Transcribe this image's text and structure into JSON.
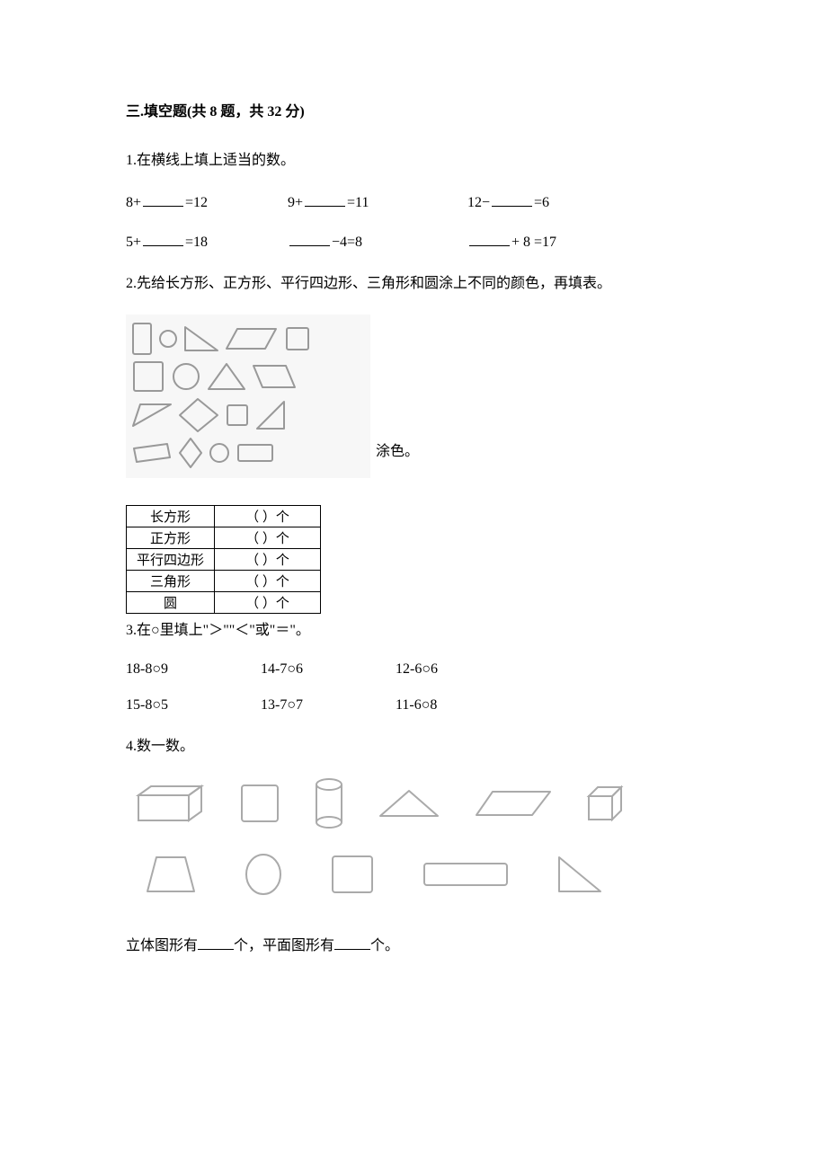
{
  "section": {
    "number": "三",
    "title": "填空题",
    "count_label": "共 8 题，共 32 分"
  },
  "q1": {
    "prompt": "1.在横线上填上适当的数。",
    "items": [
      {
        "pre": "8+",
        "post": "=12"
      },
      {
        "pre": "9+",
        "post": "=11"
      },
      {
        "pre": "12−",
        "post": "=6"
      },
      {
        "pre": "5+",
        "post": "=18"
      },
      {
        "pre": "",
        "post": "−4=8"
      },
      {
        "pre": "",
        "post": "+ 8 =17"
      }
    ]
  },
  "q2": {
    "prompt": "2.先给长方形、正方形、平行四边形、三角形和圆涂上不同的颜色，再填表。",
    "color_label": "涂色。",
    "table_rows": [
      {
        "label": "长方形",
        "value": "（      ）个"
      },
      {
        "label": "正方形",
        "value": "（      ）个"
      },
      {
        "label": "平行四边形",
        "value": "（      ）个"
      },
      {
        "label": "三角形",
        "value": "（      ）个"
      },
      {
        "label": "圆",
        "value": "（      ）个"
      }
    ]
  },
  "q3": {
    "prompt": "3.在○里填上\"＞\"\"＜\"或\"＝\"。",
    "items": [
      "18-8○9",
      "14-7○6",
      "12-6○6",
      "15-8○5",
      "13-7○7",
      "11-6○8"
    ]
  },
  "q4": {
    "prompt": "4.数一数。",
    "sentence_parts": [
      "立体图形有",
      "个，平面图形有",
      "个。"
    ]
  }
}
